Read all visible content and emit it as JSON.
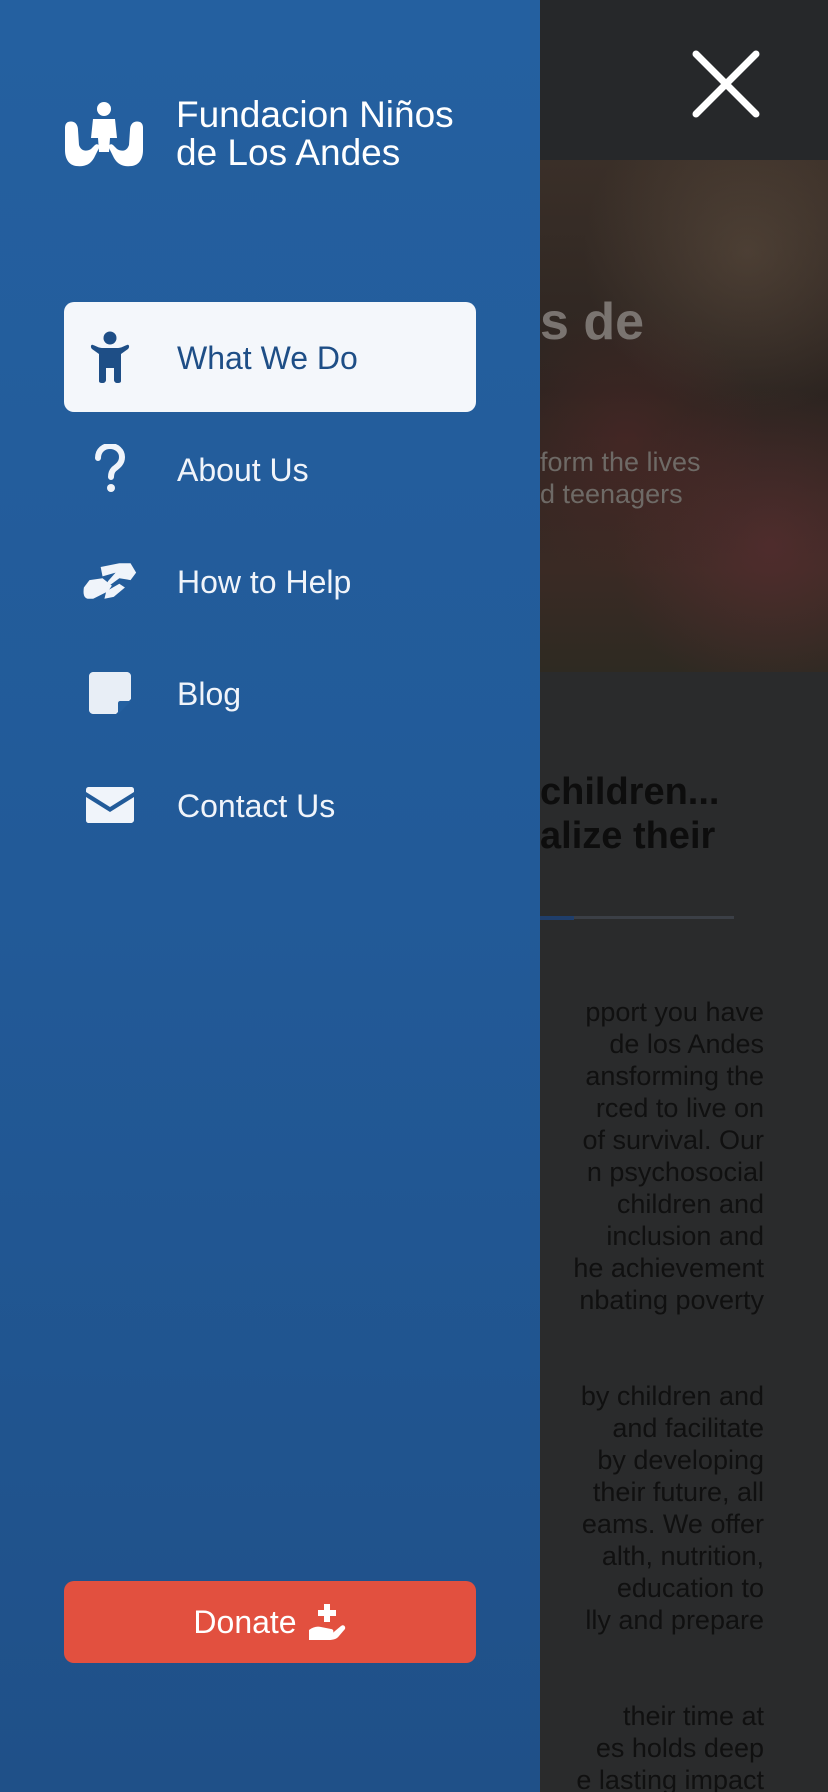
{
  "brand": {
    "name_line1": "Fundacion Niños",
    "name_line2": "de Los Andes",
    "logo_icon": "hands-holding-child-icon"
  },
  "nav": {
    "items": [
      {
        "label": "What We Do",
        "icon": "child-icon",
        "active": true
      },
      {
        "label": "About Us",
        "icon": "question-icon",
        "active": false
      },
      {
        "label": "How to Help",
        "icon": "handshake-icon",
        "active": false
      },
      {
        "label": "Blog",
        "icon": "note-icon",
        "active": false
      },
      {
        "label": "Contact Us",
        "icon": "envelope-icon",
        "active": false
      }
    ]
  },
  "donate": {
    "label": "Donate",
    "icon": "hand-holding-medical-icon"
  },
  "header": {
    "close_icon": "close-icon"
  },
  "background_page": {
    "hero_title": "s de",
    "hero_subtitle": [
      "form the lives",
      "d teenagers"
    ],
    "section_heading": [
      "children...",
      "alize their"
    ],
    "paragraph1": [
      "pport you have",
      "de los Andes",
      "ansforming the",
      "rced to live on",
      "of survival. Our",
      "n psychosocial",
      "children and",
      "inclusion and",
      "he achievement",
      "nbating poverty"
    ],
    "paragraph2": [
      "by children and",
      "and facilitate",
      "by developing",
      "their future, all",
      "eams. We offer",
      "alth, nutrition,",
      "education to",
      "lly and prepare"
    ],
    "paragraph3": [
      "their time at",
      "es holds deep",
      "e lasting impact"
    ]
  },
  "colors": {
    "drawer": "#2460a0",
    "active_item_bg": "#f4f7fb",
    "active_item_text": "#1e4e86",
    "donate": "#e2503f",
    "overlay": "#2a2b2c"
  }
}
